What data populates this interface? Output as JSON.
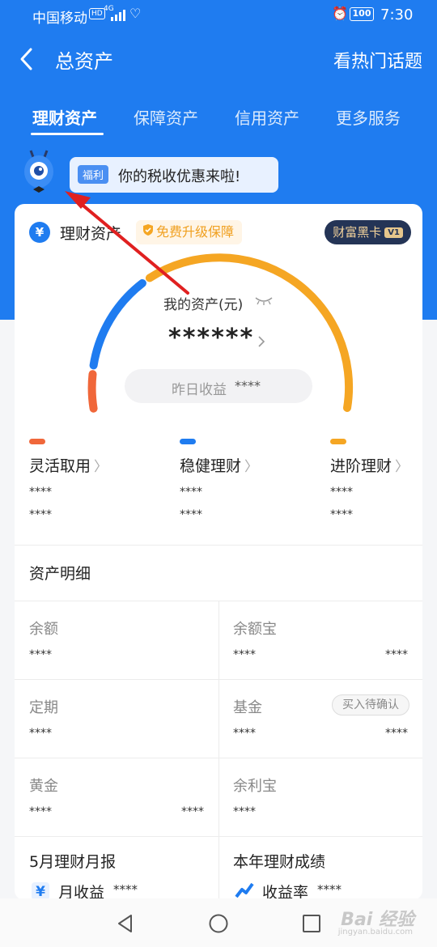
{
  "status_bar": {
    "carrier": "中国移动",
    "hd": "HD",
    "network": "4G",
    "battery": "100",
    "time": "7:30"
  },
  "header": {
    "title": "总资产",
    "right_link": "看热门话题"
  },
  "tabs": [
    {
      "label": "理财资产",
      "active": true
    },
    {
      "label": "保障资产",
      "active": false
    },
    {
      "label": "信用资产",
      "active": false
    },
    {
      "label": "更多服务",
      "active": false
    }
  ],
  "promo": {
    "tag": "福利",
    "text": "你的税收优惠来啦!"
  },
  "card": {
    "yen_symbol": "¥",
    "title": "理财资产",
    "upgrade_label": "免费升级保障",
    "blackcard_label": "财富黑卡",
    "blackcard_level": "V1",
    "asset_label": "我的资产(元)",
    "asset_value": "******",
    "yesterday_label": "昨日收益",
    "yesterday_value": "****"
  },
  "categories": [
    {
      "name": "灵活取用",
      "v1": "****",
      "v2": "****",
      "color": "#f0673a"
    },
    {
      "name": "稳健理财",
      "v1": "****",
      "v2": "****",
      "color": "#1f7cf0"
    },
    {
      "name": "进阶理财",
      "v1": "****",
      "v2": "****",
      "color": "#f5a623"
    }
  ],
  "details": {
    "title": "资产明细",
    "cells": [
      {
        "label": "余额",
        "value": "****",
        "value2": ""
      },
      {
        "label": "余额宝",
        "value": "****",
        "value2": "****"
      },
      {
        "label": "定期",
        "value": "****",
        "value2": ""
      },
      {
        "label": "基金",
        "value": "****",
        "value2": "****",
        "badge": "买入待确认"
      },
      {
        "label": "黄金",
        "value": "****",
        "value2": "****"
      },
      {
        "label": "余利宝",
        "value": "****",
        "value2": ""
      }
    ]
  },
  "reports": [
    {
      "title": "5月理财月报",
      "label": "月收益",
      "value": "****"
    },
    {
      "title": "本年理财成绩",
      "label": "收益率",
      "value": "****"
    }
  ],
  "watermark": {
    "text": "Bai 经验",
    "sub": "jingyan.baidu.com"
  },
  "colors": {
    "brand_blue": "#1f7cf0",
    "orange": "#f5a623",
    "red_orange": "#f0673a",
    "annotation_red": "#e02020"
  }
}
